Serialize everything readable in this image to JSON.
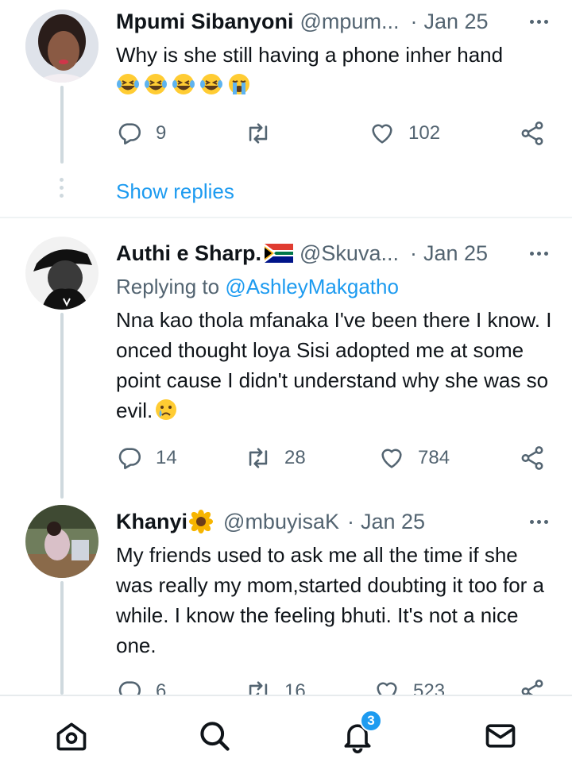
{
  "tweets": [
    {
      "name": "Mpumi Sibanyoni",
      "handle": "@mpum...",
      "separator": "·",
      "date": "Jan 25",
      "text": "Why is she still having a phone inher hand",
      "emojis": [
        "laughing-crying",
        "laughing-crying",
        "laughing-crying",
        "laughing-crying",
        "loudly-crying"
      ],
      "replies": "9",
      "retweets": "",
      "likes": "102",
      "show_replies": "Show replies"
    },
    {
      "name": "Authi e Sharp.",
      "flag": "south-africa-flag",
      "handle": "@Skuva...",
      "separator": "·",
      "date": "Jan 25",
      "replying_prefix": "Replying to",
      "replying_to": "@AshleyMakgatho",
      "text": "Nna kao thola mfanaka I've been there I know. I onced thought loya Sisi adopted me at some point cause I didn't understand why she was so evil.",
      "emojis": [
        "crying-face"
      ],
      "replies": "14",
      "retweets": "28",
      "likes": "784"
    },
    {
      "name": "Khanyi",
      "name_emoji": "sunflower",
      "handle": "@mbuyisaK",
      "separator": "·",
      "date": "Jan 25",
      "text": "My friends used to ask me all the time if she was really my mom,started doubting it too for a while. I know the feeling bhuti. It's not a nice one.",
      "replies": "6",
      "retweets": "16",
      "likes": "523"
    }
  ],
  "nav": {
    "items": [
      "home-icon",
      "search-icon",
      "notifications-icon",
      "messages-icon"
    ],
    "notification_badge": "3"
  },
  "colors": {
    "accent": "#1d9bf0",
    "text": "#0f1419",
    "muted": "#536471",
    "thread_line": "#cfd9de"
  }
}
